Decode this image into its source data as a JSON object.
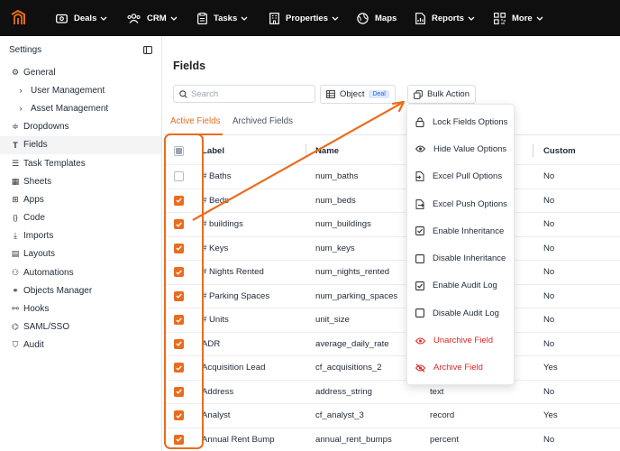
{
  "nav": {
    "items": [
      {
        "label": "Deals",
        "icon": "deals-icon",
        "dropdown": true
      },
      {
        "label": "CRM",
        "icon": "crm-icon",
        "dropdown": true
      },
      {
        "label": "Tasks",
        "icon": "tasks-icon",
        "dropdown": true
      },
      {
        "label": "Properties",
        "icon": "properties-icon",
        "dropdown": true
      },
      {
        "label": "Maps",
        "icon": "maps-icon",
        "dropdown": false
      },
      {
        "label": "Reports",
        "icon": "reports-icon",
        "dropdown": true
      },
      {
        "label": "More",
        "icon": "more-icon",
        "dropdown": true
      }
    ]
  },
  "sidebar": {
    "title": "Settings",
    "items": [
      {
        "label": "General",
        "icon": "gear-icon"
      },
      {
        "label": "User Management",
        "icon": "chevron-right-icon"
      },
      {
        "label": "Asset Management",
        "icon": "chevron-right-icon"
      },
      {
        "label": "Dropdowns",
        "icon": "dropdown-icon"
      },
      {
        "label": "Fields",
        "icon": "text-field-icon"
      },
      {
        "label": "Task Templates",
        "icon": "task-templates-icon"
      },
      {
        "label": "Sheets",
        "icon": "sheets-icon"
      },
      {
        "label": "Apps",
        "icon": "apps-icon"
      },
      {
        "label": "Code",
        "icon": "code-icon"
      },
      {
        "label": "Imports",
        "icon": "import-icon"
      },
      {
        "label": "Layouts",
        "icon": "layouts-icon"
      },
      {
        "label": "Automations",
        "icon": "automations-icon"
      },
      {
        "label": "Objects Manager",
        "icon": "objects-icon"
      },
      {
        "label": "Hooks",
        "icon": "hooks-icon"
      },
      {
        "label": "SAML/SSO",
        "icon": "saml-icon"
      },
      {
        "label": "Audit",
        "icon": "shield-icon"
      }
    ]
  },
  "main": {
    "title": "Fields",
    "search_placeholder": "Search",
    "object_label": "Object",
    "object_badge": "Deal",
    "bulk_action_label": "Bulk Action",
    "tabs": [
      "Active Fields",
      "Archived Fields"
    ],
    "columns": {
      "label": "Label",
      "name": "Name",
      "custom": "Custom"
    },
    "rows": [
      {
        "label": "# Baths",
        "name": "num_baths",
        "type": "",
        "custom": "No",
        "checked": false
      },
      {
        "label": "# Beds",
        "name": "num_beds",
        "type": "",
        "custom": "No",
        "checked": true
      },
      {
        "label": "# buildings",
        "name": "num_buildings",
        "type": "",
        "custom": "No",
        "checked": true
      },
      {
        "label": "# Keys",
        "name": "num_keys",
        "type": "",
        "custom": "No",
        "checked": true
      },
      {
        "label": "# Nights Rented",
        "name": "num_nights_rented",
        "type": "",
        "custom": "No",
        "checked": true
      },
      {
        "label": "# Parking Spaces",
        "name": "num_parking_spaces",
        "type": "",
        "custom": "No",
        "checked": true
      },
      {
        "label": "# Units",
        "name": "unit_size",
        "type": "",
        "custom": "No",
        "checked": true
      },
      {
        "label": "ADR",
        "name": "average_daily_rate",
        "type": "",
        "custom": "No",
        "checked": true
      },
      {
        "label": "Acquisition Lead",
        "name": "cf_acquisitions_2",
        "type": "",
        "custom": "Yes",
        "checked": true
      },
      {
        "label": "Address",
        "name": "address_string",
        "type": "text",
        "custom": "No",
        "checked": true
      },
      {
        "label": "Analyst",
        "name": "cf_analyst_3",
        "type": "record",
        "custom": "Yes",
        "checked": true
      },
      {
        "label": "Annual Rent Bump",
        "name": "annual_rent_bumps",
        "type": "percent",
        "custom": "No",
        "checked": true
      }
    ]
  },
  "bulk_menu": {
    "items": [
      {
        "label": "Lock Fields Options",
        "icon": "lock-icon",
        "danger": false
      },
      {
        "label": "Hide Value Options",
        "icon": "eye-icon",
        "danger": false
      },
      {
        "label": "Excel Pull Options",
        "icon": "file-import-icon",
        "danger": false
      },
      {
        "label": "Excel Push Options",
        "icon": "file-export-icon",
        "danger": false
      },
      {
        "label": "Enable Inheritance",
        "icon": "checkbox-checked-icon",
        "danger": false
      },
      {
        "label": "Disable Inheritance",
        "icon": "checkbox-empty-icon",
        "danger": false
      },
      {
        "label": "Enable Audit Log",
        "icon": "checkbox-checked-icon",
        "danger": false
      },
      {
        "label": "Disable Audit Log",
        "icon": "checkbox-empty-icon",
        "danger": false
      },
      {
        "label": "Unarchive Field",
        "icon": "unarchive-icon",
        "danger": true
      },
      {
        "label": "Archive Field",
        "icon": "archive-icon",
        "danger": true
      }
    ]
  },
  "colors": {
    "accent": "#ea6c1e",
    "danger": "#dc2626",
    "topbar": "#0f0f0f"
  }
}
